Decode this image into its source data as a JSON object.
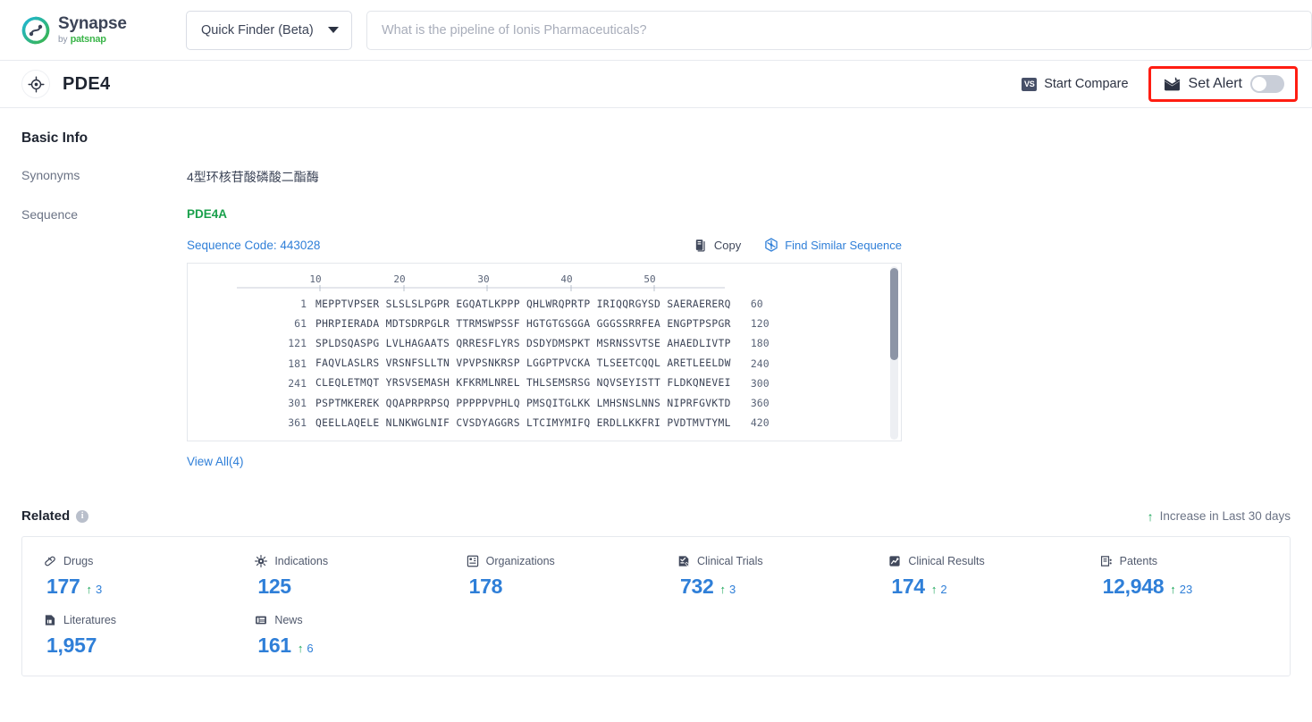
{
  "topbar": {
    "logo": {
      "name": "Synapse",
      "by": "by",
      "brand": "patsnap",
      "icon": "synapse-logo-icon"
    },
    "finder": {
      "label": "Quick Finder (Beta)",
      "caret_icon": "chevron-down-icon"
    },
    "search": {
      "value": "",
      "placeholder": "What is the pipeline of Ionis Pharmaceuticals?"
    }
  },
  "entity": {
    "icon": "target-icon",
    "title": "PDE4",
    "actions": {
      "compare": {
        "label": "Start Compare",
        "icon": "vs-icon",
        "badge_text": "VS"
      },
      "alert": {
        "label": "Set Alert",
        "icon": "mail-alert-icon",
        "toggle_state": "off",
        "highlight_color": "#ff1d12"
      }
    }
  },
  "basic_info": {
    "heading": "Basic Info",
    "rows": [
      {
        "label": "Synonyms",
        "value": "4型环核苷酸磷酸二酯酶"
      },
      {
        "label": "Sequence",
        "value": ""
      }
    ]
  },
  "sequence": {
    "name": "PDE4A",
    "code_label": "Sequence Code: 443028",
    "tools": [
      {
        "label": "Copy",
        "icon": "copy-icon"
      },
      {
        "label": "Find Similar Sequence",
        "icon": "find-similar-icon"
      }
    ],
    "ruler_ticks": [
      "10",
      "20",
      "30",
      "40",
      "50"
    ],
    "rows": [
      {
        "start": "1",
        "blocks": [
          "MEPPTVPSER",
          "SLSLSLPGPR",
          "EGQATLKPPP",
          "QHLWRQPRTP",
          "IRIQQRGYSD",
          "SAERAERERQ"
        ],
        "end": "60"
      },
      {
        "start": "61",
        "blocks": [
          "PHRPIERADA",
          "MDTSDRPGLR",
          "TTRMSWPSSF",
          "HGTGTGSGGA",
          "GGGSSRRFEA",
          "ENGPTPSPGR"
        ],
        "end": "120"
      },
      {
        "start": "121",
        "blocks": [
          "SPLDSQASPG",
          "LVLHAGAATS",
          "QRRESFLYRS",
          "DSDYDMSPKT",
          "MSRNSSVTSE",
          "AHAEDLIVTP"
        ],
        "end": "180"
      },
      {
        "start": "181",
        "blocks": [
          "FAQVLASLRS",
          "VRSNFSLLTN",
          "VPVPSNKRSP",
          "LGGPTPVCKA",
          "TLSEETCQQL",
          "ARETLEELDW"
        ],
        "end": "240"
      },
      {
        "start": "241",
        "blocks": [
          "CLEQLETMQT",
          "YRSVSEMASH",
          "KFKRMLNREL",
          "THLSEMSRSG",
          "NQVSEYISTT",
          "FLDKQNEVEI"
        ],
        "end": "300"
      },
      {
        "start": "301",
        "blocks": [
          "PSPTMKEREK",
          "QQAPRPRPSQ",
          "PPPPPVPHLQ",
          "PMSQITGLKK",
          "LMHSNSLNNS",
          "NIPRFGVKTD"
        ],
        "end": "360"
      },
      {
        "start": "361",
        "blocks": [
          "QEELLAQELE",
          "NLNKWGLNIF",
          "CVSDYAGGRS",
          "LTCIMYMIFQ",
          "ERDLLKKFRI",
          "PVDTMVTYML"
        ],
        "end": "420"
      }
    ],
    "view_all": "View All(4)"
  },
  "related": {
    "heading": "Related",
    "info_icon": "info-icon",
    "legend": {
      "arrow": "▲",
      "label": "Increase in Last 30 days"
    },
    "stats": [
      {
        "label": "Drugs",
        "icon": "pill-icon",
        "value": "177",
        "delta": "3"
      },
      {
        "label": "Indications",
        "icon": "virus-icon",
        "value": "125",
        "delta": ""
      },
      {
        "label": "Organizations",
        "icon": "organization-icon",
        "value": "178",
        "delta": ""
      },
      {
        "label": "Clinical Trials",
        "icon": "clinical-trial-icon",
        "value": "732",
        "delta": "3"
      },
      {
        "label": "Clinical Results",
        "icon": "clinical-result-icon",
        "value": "174",
        "delta": "2"
      },
      {
        "label": "Patents",
        "icon": "patent-icon",
        "value": "12,948",
        "delta": "23"
      },
      {
        "label": "Literatures",
        "icon": "literature-icon",
        "value": "1,957",
        "delta": ""
      },
      {
        "label": "News",
        "icon": "news-icon",
        "value": "161",
        "delta": "6"
      }
    ]
  },
  "colors": {
    "accent_blue": "#2f7fd8",
    "green": "#18a558",
    "seq_green": "#19a04b",
    "alert_red": "#ff1d12"
  }
}
